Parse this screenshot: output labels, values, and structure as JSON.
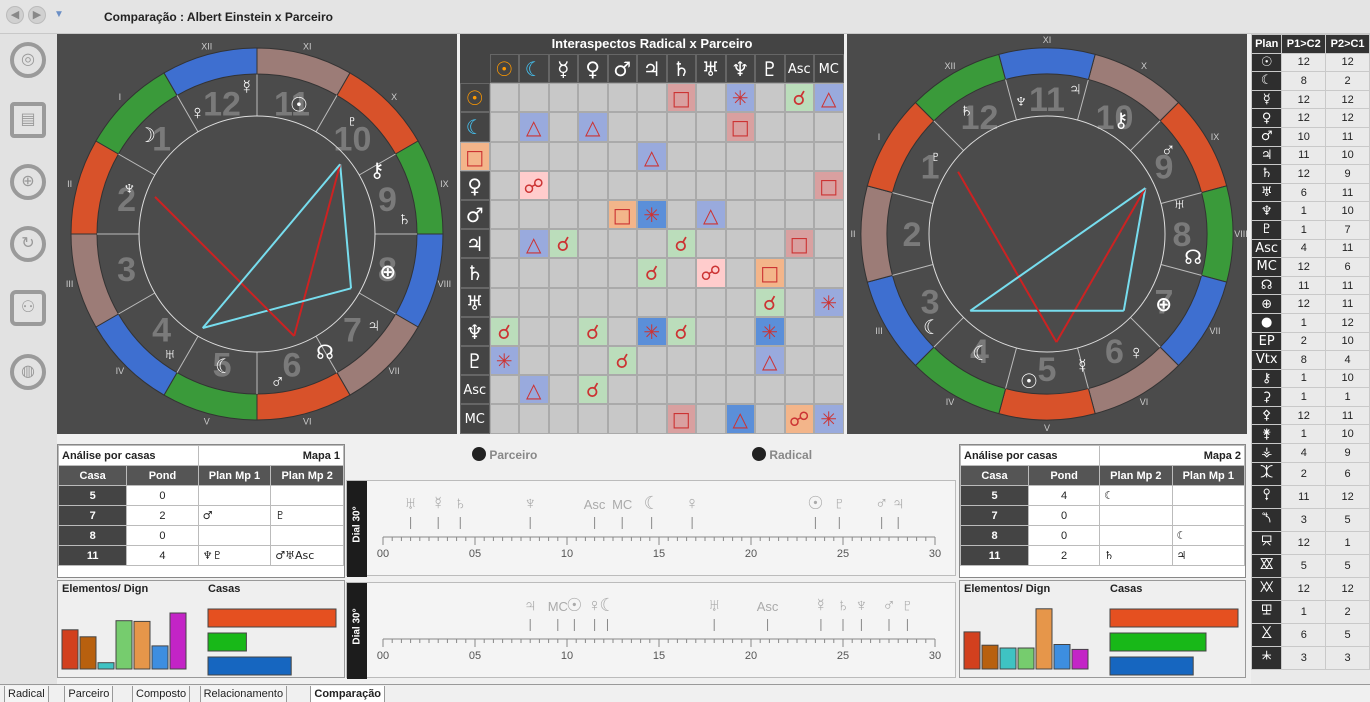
{
  "window": {
    "title": "Comparação : Albert Einstein  x  Parceiro",
    "back_icon": "back-arrow-icon",
    "forward_icon": "forward-arrow-icon"
  },
  "sidebar": {
    "icons": [
      "wheel-icon",
      "report-clock-icon",
      "globe-pin-icon",
      "cycle-icon",
      "people-icon",
      "world-icon"
    ]
  },
  "chart1": {
    "houses": [
      "XI",
      "X",
      "IX",
      "VIII",
      "VII",
      "VI",
      "V",
      "IV",
      "III",
      "II",
      "I",
      "XII"
    ],
    "big_numbers": [
      "11",
      "10",
      "9",
      "8",
      "7",
      "6",
      "5",
      "4",
      "3",
      "2",
      "1",
      "12"
    ],
    "planets": [
      "♆",
      "☽",
      "♀",
      "☿",
      "☉",
      "♇",
      "⚷",
      "♄",
      "⊕",
      "♃",
      "☊",
      "♂",
      "☾",
      "♅"
    ]
  },
  "grid": {
    "title": "Interaspectos Radical x Parceiro",
    "col_headers": [
      "☉",
      "☾",
      "☿",
      "♀",
      "♂",
      "♃",
      "♄",
      "♅",
      "♆",
      "♇",
      "Asc",
      "MC"
    ],
    "row_headers": [
      "☉",
      "☾",
      "☿",
      "♀",
      "♂",
      "♃",
      "♄",
      "♅",
      "♆",
      "♇",
      "Asc",
      "MC"
    ],
    "aspects": [
      [
        0,
        7,
        "□",
        "#d9a0a0"
      ],
      [
        0,
        9,
        "✳",
        "#9ad"
      ],
      [
        0,
        11,
        "☌",
        "#bdb"
      ],
      [
        0,
        12,
        "△",
        "#9ad"
      ],
      [
        1,
        2,
        "△",
        "#9ad"
      ],
      [
        1,
        4,
        "△",
        "#9ad"
      ],
      [
        1,
        9,
        "□",
        "#d9a0a0"
      ],
      [
        2,
        0,
        "□",
        "#f3b58a"
      ],
      [
        2,
        6,
        "△",
        "#9ad"
      ],
      [
        3,
        2,
        "☍",
        "#fcc"
      ],
      [
        3,
        12,
        "□",
        "#d9a0a0"
      ],
      [
        4,
        5,
        "□",
        "#f3b58a"
      ],
      [
        4,
        6,
        "✳",
        "#5b8fd9"
      ],
      [
        4,
        8,
        "△",
        "#9ad"
      ],
      [
        5,
        2,
        "△",
        "#9ad"
      ],
      [
        5,
        3,
        "☌",
        "#bdb"
      ],
      [
        5,
        7,
        "☌",
        "#bdb"
      ],
      [
        5,
        11,
        "□",
        "#d9a0a0"
      ],
      [
        6,
        6,
        "☌",
        "#bdb"
      ],
      [
        6,
        8,
        "☍",
        "#fcc"
      ],
      [
        6,
        10,
        "□",
        "#f3b58a"
      ],
      [
        7,
        10,
        "☌",
        "#bdb"
      ],
      [
        7,
        12,
        "✳",
        "#9ad"
      ],
      [
        8,
        1,
        "☌",
        "#bdb"
      ],
      [
        8,
        4,
        "☌",
        "#bdb"
      ],
      [
        8,
        6,
        "✳",
        "#5b8fd9"
      ],
      [
        8,
        7,
        "☌",
        "#bdb"
      ],
      [
        8,
        10,
        "✳",
        "#5b8fd9"
      ],
      [
        9,
        1,
        "✳",
        "#9ad"
      ],
      [
        9,
        5,
        "☌",
        "#bdb"
      ],
      [
        9,
        10,
        "△",
        "#9ad"
      ],
      [
        10,
        2,
        "△",
        "#9ad"
      ],
      [
        10,
        4,
        "☌",
        "#bdb"
      ],
      [
        11,
        7,
        "□",
        "#d9a0a0"
      ],
      [
        11,
        9,
        "△",
        "#5b8fd9"
      ],
      [
        11,
        11,
        "☍",
        "#f3b58a"
      ],
      [
        11,
        12,
        "✳",
        "#9ad"
      ]
    ]
  },
  "chart2": {
    "houses": [
      "X",
      "IX",
      "VIII",
      "VII",
      "VI",
      "V",
      "IV",
      "III",
      "II",
      "I",
      "XII",
      "XI"
    ],
    "big_numbers": [
      "10",
      "9",
      "8",
      "7",
      "6",
      "5",
      "4",
      "3",
      "2",
      "1",
      "12",
      "11"
    ],
    "planets": [
      "♇",
      "♄",
      "♆",
      "♃",
      "⚷",
      "♂",
      "♅",
      "☊",
      "⊕",
      "♀",
      "☿",
      "☉",
      "☾",
      "☾"
    ]
  },
  "analysis1": {
    "title": "Análise por casas",
    "map": "Mapa 1",
    "headers": [
      "Casa",
      "Pond",
      "Plan Mp 1",
      "Plan Mp 2"
    ],
    "rows": [
      [
        "5",
        "0",
        "",
        ""
      ],
      [
        "7",
        "2",
        "♂",
        "♇"
      ],
      [
        "8",
        "0",
        "",
        ""
      ],
      [
        "11",
        "4",
        "♆♇",
        "♂♅Asc"
      ]
    ]
  },
  "analysis2": {
    "title": "Análise por casas",
    "map": "Mapa 2",
    "headers": [
      "Casa",
      "Pond",
      "Plan Mp 2",
      "Plan Mp 1"
    ],
    "rows": [
      [
        "5",
        "4",
        "☾",
        ""
      ],
      [
        "7",
        "0",
        "",
        ""
      ],
      [
        "8",
        "0",
        "",
        "☾"
      ],
      [
        "11",
        "2",
        "♄",
        "♃"
      ]
    ]
  },
  "legend": {
    "parceiro": "Parceiro",
    "radical": "Radical"
  },
  "dials": {
    "label": "Dial 30°",
    "ticks": [
      "00",
      "05",
      "10",
      "15",
      "20",
      "25",
      "30"
    ],
    "dial1_glyphs": [
      [
        "♅",
        1.5
      ],
      [
        "☿",
        3.0
      ],
      [
        "♄",
        4.2
      ],
      [
        "♆",
        8.0
      ],
      [
        "Asc",
        11.5
      ],
      [
        "MC",
        13.0
      ],
      [
        "☾",
        14.6
      ],
      [
        "♀",
        16.8
      ],
      [
        "☉",
        23.5
      ],
      [
        "♇",
        24.8
      ],
      [
        "♂",
        27.1
      ],
      [
        "♃",
        28.0
      ]
    ],
    "dial2_glyphs": [
      [
        "♃",
        8.0
      ],
      [
        "MC",
        9.5
      ],
      [
        "☉",
        10.4
      ],
      [
        "♀",
        11.5
      ],
      [
        "☾",
        12.2
      ],
      [
        "♅",
        18.0
      ],
      [
        "Asc",
        20.9
      ],
      [
        "☿",
        23.8
      ],
      [
        "♄",
        25.0
      ],
      [
        "♆",
        26.0
      ],
      [
        "♂",
        27.5
      ],
      [
        "♇",
        28.5
      ]
    ]
  },
  "elements1": {
    "title": "Elementos/ Dign",
    "casas": "Casas",
    "bars": [
      0.56,
      0.46,
      0.09,
      0.69,
      0.68,
      0.33,
      0.8
    ],
    "colors": [
      "#d2401e",
      "#b8600e",
      "#3fc3c3",
      "#76cc6e",
      "#e6964a",
      "#3d8ee0",
      "#c324c6"
    ],
    "hbar_colors": [
      "#e55020",
      "#18b818",
      "#1666c0"
    ],
    "hbar_values": [
      1.0,
      0.3,
      0.65
    ]
  },
  "elements2": {
    "title": "Elementos/ Dign",
    "casas": "Casas",
    "bars": [
      0.53,
      0.34,
      0.3,
      0.3,
      0.86,
      0.35,
      0.28
    ],
    "colors": [
      "#d2401e",
      "#b8600e",
      "#3fc3c3",
      "#76cc6e",
      "#e6964a",
      "#3d8ee0",
      "#c324c6"
    ],
    "hbar_colors": [
      "#e55020",
      "#18b818",
      "#1666c0"
    ],
    "hbar_values": [
      1.0,
      0.75,
      0.65
    ]
  },
  "right_table": {
    "headers": [
      "Plan",
      "P1>C2",
      "P2>C1"
    ],
    "rows": [
      [
        "☉",
        "12",
        "12"
      ],
      [
        "☾",
        "8",
        "2"
      ],
      [
        "☿",
        "12",
        "12"
      ],
      [
        "♀",
        "12",
        "12"
      ],
      [
        "♂",
        "10",
        "11"
      ],
      [
        "♃",
        "11",
        "10"
      ],
      [
        "♄",
        "12",
        "9"
      ],
      [
        "♅",
        "6",
        "11"
      ],
      [
        "♆",
        "1",
        "10"
      ],
      [
        "♇",
        "1",
        "7"
      ],
      [
        "Asc",
        "4",
        "11"
      ],
      [
        "MC",
        "12",
        "6"
      ],
      [
        "☊",
        "11",
        "11"
      ],
      [
        "⊕",
        "12",
        "11"
      ],
      [
        "●",
        "1",
        "12"
      ],
      [
        "EP",
        "2",
        "10"
      ],
      [
        "Vtx",
        "8",
        "4"
      ],
      [
        "⚷",
        "1",
        "10"
      ],
      [
        "⚳",
        "1",
        "1"
      ],
      [
        "⚴",
        "12",
        "11"
      ],
      [
        "⚵",
        "1",
        "10"
      ],
      [
        "⚶",
        "4",
        "9"
      ],
      [
        "⯰",
        "2",
        "6"
      ],
      [
        "⯱",
        "11",
        "12"
      ],
      [
        "⯲",
        "3",
        "5"
      ],
      [
        "⯳",
        "12",
        "1"
      ],
      [
        "⯴",
        "5",
        "5"
      ],
      [
        "⯵",
        "12",
        "12"
      ],
      [
        "⯶",
        "1",
        "2"
      ],
      [
        "⯷",
        "6",
        "5"
      ],
      [
        "⯸",
        "3",
        "3"
      ]
    ]
  },
  "tabs": [
    "Radical",
    "Parceiro",
    "Composto",
    "Relacionamento",
    "Comparação"
  ],
  "active_tab": 4
}
